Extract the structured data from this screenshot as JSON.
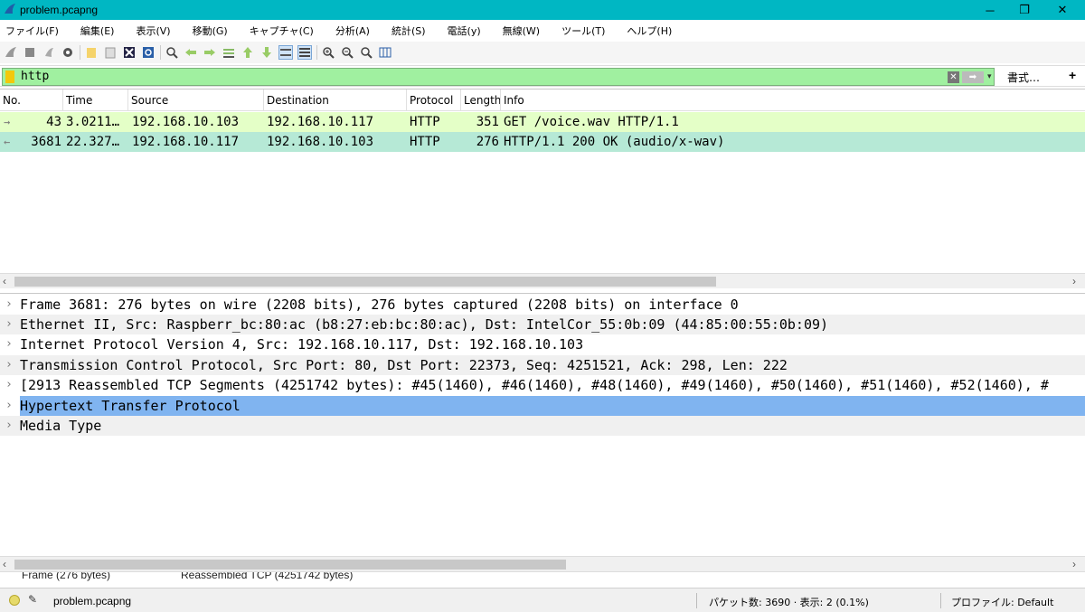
{
  "window": {
    "title": "problem.pcapng",
    "minimize": "─",
    "maximize": "❐",
    "close": "✕"
  },
  "menu": [
    "ファイル(F)",
    "編集(E)",
    "表示(V)",
    "移動(G)",
    "キャプチャ(C)",
    "分析(A)",
    "統計(S)",
    "電話(y)",
    "無線(W)",
    "ツール(T)",
    "ヘルプ(H)"
  ],
  "toolbar": {
    "icons": [
      "shark-fin-start-icon",
      "stop-icon",
      "restart-icon",
      "options-gear-icon",
      "open-file-icon",
      "save-file-icon",
      "close-file-icon",
      "reload-icon",
      "find-icon",
      "go-back-icon",
      "go-forward-icon",
      "go-to-packet-icon",
      "first-packet-icon",
      "last-packet-icon",
      "autoscroll-icon",
      "colorize-icon",
      "zoom-in-icon",
      "zoom-out-icon",
      "normal-size-icon",
      "resize-columns-icon"
    ]
  },
  "filter": {
    "value": "http",
    "clear": "✕",
    "apply": "➡",
    "dropdown": "▾",
    "expressions_label": "書式…",
    "add_label": "+",
    "bookmark_color": "#f3c80b",
    "background_color": "#a0f0a0"
  },
  "packet_list": {
    "columns": [
      "No.",
      "Time",
      "Source",
      "Destination",
      "Protocol",
      "Length",
      "Info"
    ],
    "rows": [
      {
        "arrow": "→",
        "no": "43",
        "time": "3.0211…",
        "source": "192.168.10.103",
        "destination": "192.168.10.117",
        "protocol": "HTTP",
        "length": "351",
        "info": "GET /voice.wav HTTP/1.1",
        "bg": "#e4ffc7"
      },
      {
        "arrow": "←",
        "no": "3681",
        "time": "22.327…",
        "source": "192.168.10.117",
        "destination": "192.168.10.103",
        "protocol": "HTTP",
        "length": "276",
        "info": "HTTP/1.1 200 OK  (audio/x-wav)",
        "bg": "#b6e9d6"
      }
    ]
  },
  "details": {
    "rows": [
      "Frame 3681: 276 bytes on wire (2208 bits), 276 bytes captured (2208 bits) on interface 0",
      "Ethernet II, Src: Raspberr_bc:80:ac (b8:27:eb:bc:80:ac), Dst: IntelCor_55:0b:09 (44:85:00:55:0b:09)",
      "Internet Protocol Version 4, Src: 192.168.10.117, Dst: 192.168.10.103",
      "Transmission Control Protocol, Src Port: 80, Dst Port: 22373, Seq: 4251521, Ack: 298, Len: 222",
      "[2913 Reassembled TCP Segments (4251742 bytes): #45(1460), #46(1460), #48(1460), #49(1460), #50(1460), #51(1460), #52(1460), #",
      "Hypertext Transfer Protocol",
      "Media Type"
    ],
    "selected_index": 5,
    "selected_color": "#80b4f0"
  },
  "bytes_tabs": [
    "Frame (276 bytes)",
    "Reassembled TCP (4251742 bytes)"
  ],
  "status": {
    "file": "problem.pcapng",
    "packets": "パケット数: 3690 · 表示: 2 (0.1%)",
    "profile": "プロファイル: Default"
  }
}
